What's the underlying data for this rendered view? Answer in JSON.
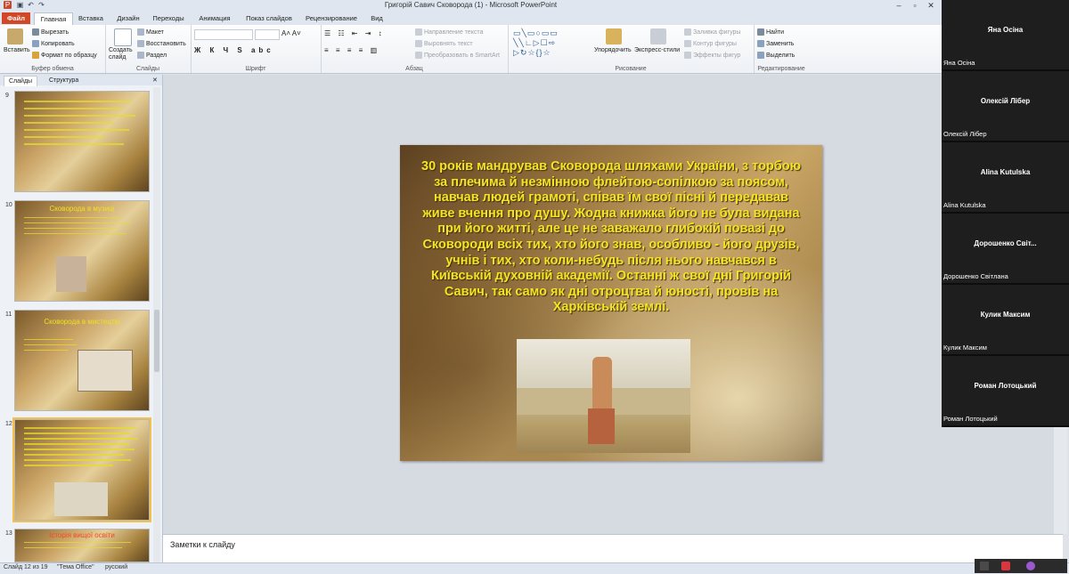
{
  "window": {
    "title": "Григорій Савич Сковорода (1) - Microsoft PowerPoint"
  },
  "tabs": [
    "Файл",
    "Главная",
    "Вставка",
    "Дизайн",
    "Переходы",
    "Анимация",
    "Показ слайдов",
    "Рецензирование",
    "Вид"
  ],
  "ribbon": {
    "clipboard": {
      "paste": "Вставить",
      "cut": "Вырезать",
      "copy": "Копировать",
      "format_painter": "Формат по образцу",
      "label": "Буфер обмена"
    },
    "slides": {
      "new_slide": "Создать слайд",
      "layout": "Макет",
      "reset": "Восстановить",
      "section": "Раздел",
      "label": "Слайды"
    },
    "font": {
      "label": "Шрифт"
    },
    "paragraph": {
      "text_direction": "Направление текста",
      "align_text": "Выровнять текст",
      "smartart": "Преобразовать в SmartArt",
      "label": "Абзац"
    },
    "drawing": {
      "arrange": "Упорядочить",
      "quick_styles": "Экспресс-стили",
      "fill": "Заливка фигуры",
      "outline": "Контур фигуры",
      "effects": "Эффекты фигур",
      "label": "Рисование"
    },
    "editing": {
      "find": "Найти",
      "replace": "Заменить",
      "select": "Выделить",
      "label": "Редактирование"
    }
  },
  "panel": {
    "tab_slides": "Слайды",
    "tab_outline": "Структура",
    "thumbs": [
      {
        "num": "9",
        "title": ""
      },
      {
        "num": "10",
        "title": "Сковорода в музиці"
      },
      {
        "num": "11",
        "title": "Сковорода в мистецтві"
      },
      {
        "num": "12",
        "title": ""
      },
      {
        "num": "13",
        "title": "Історія вищої освіти"
      }
    ]
  },
  "slide": {
    "text": "30 років мандрував Сковорода шляхами України, з торбою за плечима й незмінною флейтою-сопілкою за поясом, навчав людей грамоті, співав їм свої пісні й передавав живе вчення про душу. Жодна книжка його не була видана при його житті, але це не заважало глибокій повазі до Сковороди всіх тих, хто його знав, особливо - його друзів, учнів і тих, хто коли-небудь після нього навчався в Київській духовній академії. Останні ж свої дні Григорій Савич, так само як дні отроцтва й юності, провів на Харківській землі."
  },
  "notes": {
    "placeholder": "Заметки к слайду"
  },
  "status": {
    "slide": "Слайд 12 из 19",
    "theme": "\"Тема Office\"",
    "lang": "русский"
  },
  "participants": [
    {
      "big": "Яна Осіна",
      "small": "Яна Осіна"
    },
    {
      "big": "Олексій Лібер",
      "small": "Олексій Лібер"
    },
    {
      "big": "Alina Kutulska",
      "small": "Alina Kutulska"
    },
    {
      "big": "Дорошенко Світ...",
      "small": "Дорошенко Світлана"
    },
    {
      "big": "Кулик Максим",
      "small": "Кулик Максим"
    },
    {
      "big": "Роман Лотоцький",
      "small": "Роман Лотоцький"
    }
  ]
}
